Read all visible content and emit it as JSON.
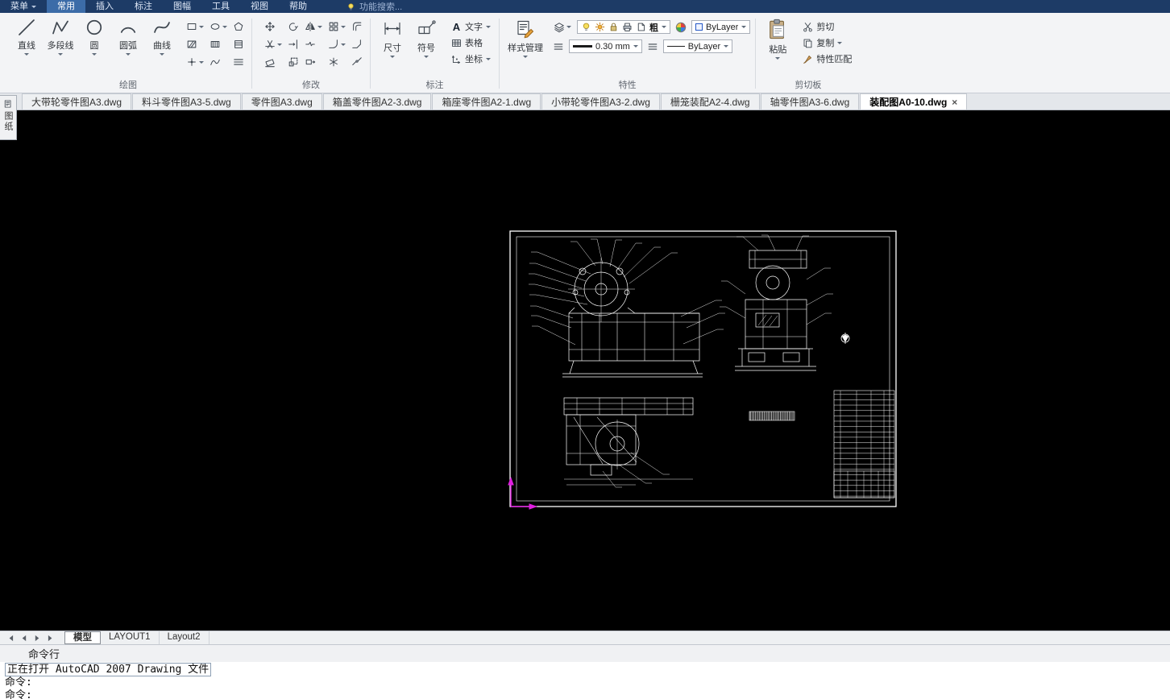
{
  "menubar": {
    "items": [
      "菜单",
      "常用",
      "插入",
      "标注",
      "图幅",
      "工具",
      "视图",
      "帮助"
    ],
    "search_label": "功能搜索..."
  },
  "ribbon": {
    "groups": {
      "draw": {
        "label": "绘图",
        "tools": [
          {
            "label": "直线"
          },
          {
            "label": "多段线"
          },
          {
            "label": "圆"
          },
          {
            "label": "圆弧"
          },
          {
            "label": "曲线"
          }
        ]
      },
      "modify": {
        "label": "修改"
      },
      "annotate": {
        "label": "标注",
        "dimension": "尺寸",
        "symbol": "符号",
        "text": "文字",
        "table": "表格",
        "coordinate": "坐标"
      },
      "properties": {
        "label": "特性",
        "style_manager": "样式管理",
        "bold_short": "粗",
        "color_value": "ByLayer",
        "lineweight_value": "0.30 mm",
        "linetype_value": "ByLayer"
      },
      "clipboard": {
        "label": "剪切板",
        "paste": "粘贴",
        "cut": "剪切",
        "copy": "复制",
        "match_properties": "特性匹配"
      }
    }
  },
  "document_tabs": [
    {
      "label": "大带轮零件图A3.dwg"
    },
    {
      "label": "料斗零件图A3-5.dwg"
    },
    {
      "label": "零件图A3.dwg"
    },
    {
      "label": "箱盖零件图A2-3.dwg"
    },
    {
      "label": "箱座零件图A2-1.dwg"
    },
    {
      "label": "小带轮零件图A3-2.dwg"
    },
    {
      "label": "栅笼装配A2-4.dwg"
    },
    {
      "label": "轴零件图A3-6.dwg"
    },
    {
      "label": "装配图A0-10.dwg",
      "active": true
    }
  ],
  "side_panel": {
    "sheet_tab": "图纸"
  },
  "layout_bar": {
    "tabs": [
      "模型",
      "LAYOUT1",
      "Layout2"
    ],
    "active_index": 0
  },
  "command_panel": {
    "title": "命令行",
    "lines": [
      "正在打开 AutoCAD 2007 Drawing 文件",
      "命令:",
      "命令:"
    ]
  },
  "icons": {
    "close": "×",
    "text_tool": "A"
  }
}
